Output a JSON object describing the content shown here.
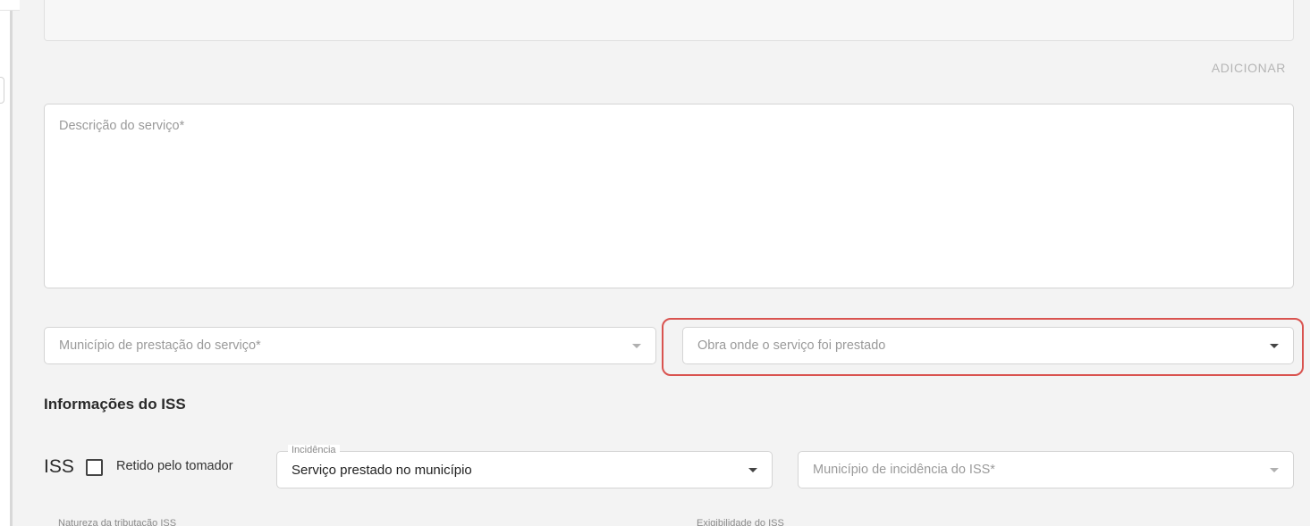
{
  "actions": {
    "add_label": "ADICIONAR"
  },
  "service": {
    "description_placeholder": "Descrição do serviço*",
    "municipality_placeholder": "Município de prestação do serviço*",
    "work_placeholder": "Obra onde o serviço foi prestado"
  },
  "iss": {
    "section_title": "Informações do ISS",
    "label": "ISS",
    "withheld_label": "Retido pelo tomador",
    "withheld_checked": false,
    "incidence_label": "Incidência",
    "incidence_value": "Serviço prestado no município",
    "incidence_municipality_placeholder": "Município de incidência do ISS*",
    "taxation_nature_label": "Natureza da tributação ISS",
    "enforceability_label": "Exigibilidade do ISS"
  },
  "colors": {
    "highlight": "#d9534f"
  },
  "icons": {
    "dropdown": "chevron-down-icon"
  }
}
